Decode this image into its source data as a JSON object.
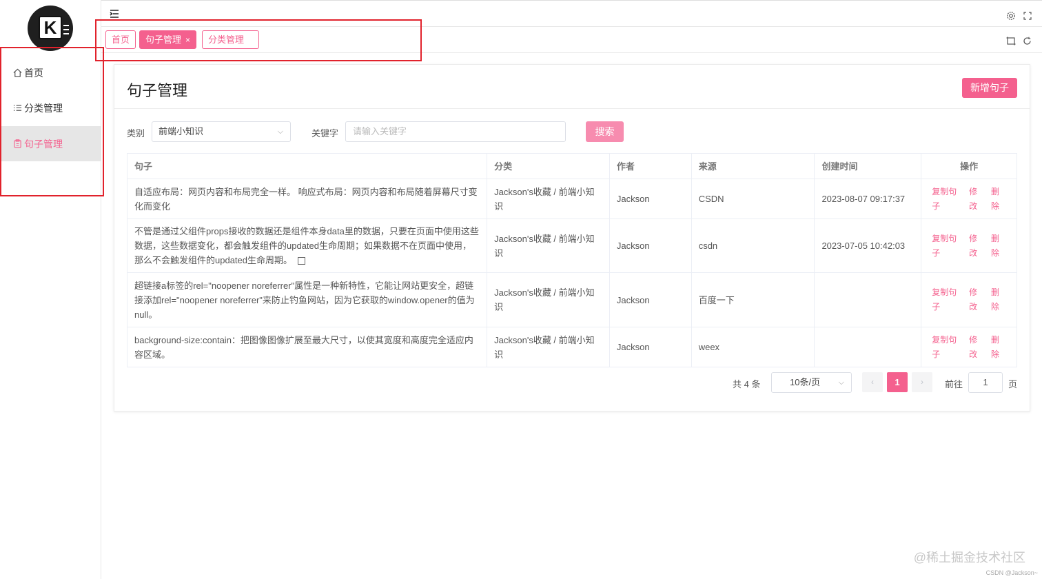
{
  "sidebar": {
    "logo_letter": "K",
    "items": [
      {
        "label": "首页"
      },
      {
        "label": "分类管理"
      },
      {
        "label": "句子管理"
      }
    ]
  },
  "tags": [
    {
      "label": "首页"
    },
    {
      "label": "句子管理",
      "close": "×"
    },
    {
      "label": "分类管理"
    }
  ],
  "card": {
    "title": "句子管理",
    "add_button": "新增句子"
  },
  "filter": {
    "category_label": "类别",
    "category_value": "前端小知识",
    "keyword_label": "关键字",
    "keyword_placeholder": "请输入关键字",
    "search_button": "搜索"
  },
  "table": {
    "headers": [
      "句子",
      "分类",
      "作者",
      "来源",
      "创建时间",
      "操作"
    ],
    "rows": [
      {
        "sentence": "自适应布局：网页内容和布局完全一样。 响应式布局：网页内容和布局随着屏幕尺寸变化而变化",
        "category": "Jackson's收藏 / 前端小知识",
        "author": "Jackson",
        "source": "CSDN",
        "created": "2023-08-07 09:17:37"
      },
      {
        "sentence": "不管是通过父组件props接收的数据还是组件本身data里的数据，只要在页面中使用这些数据，这些数据变化，都会触发组件的updated生命周期；如果数据不在页面中使用，那么不会触发组件的updated生命周期。",
        "category": "Jackson's收藏 / 前端小知识",
        "author": "Jackson",
        "source": "csdn",
        "created": "2023-07-05 10:42:03"
      },
      {
        "sentence": "超链接a标签的rel=\"noopener noreferrer\"属性是一种新特性，它能让网站更安全，超链接添加rel=\"noopener noreferrer\"来防止钓鱼网站，因为它获取的window.opener的值为null。",
        "category": "Jackson's收藏 / 前端小知识",
        "author": "Jackson",
        "source": "百度一下",
        "created": ""
      },
      {
        "sentence": "background-size:contain：把图像图像扩展至最大尺寸，以使其宽度和高度完全适应内容区域。",
        "category": "Jackson's收藏 / 前端小知识",
        "author": "Jackson",
        "source": "weex",
        "created": ""
      }
    ],
    "actions": {
      "copy": "复制句子",
      "edit": "修改",
      "delete": "删除"
    }
  },
  "pagination": {
    "total": "共 4 条",
    "page_size": "10条/页",
    "current": "1",
    "goto_label": "前往",
    "goto_value": "1",
    "page_suffix": "页",
    "prev": "‹",
    "next": "›"
  },
  "watermark": "@稀土掘金技术社区",
  "watermark_small": "CSDN @Jackson~",
  "colors": {
    "accent": "#f4608e",
    "highlight": "#e1222c"
  }
}
